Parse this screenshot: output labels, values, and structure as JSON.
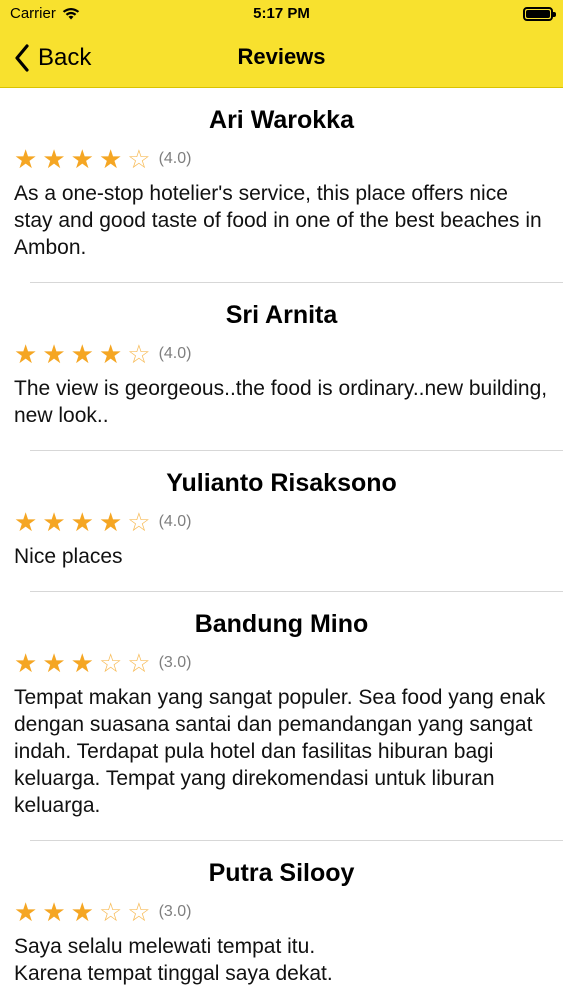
{
  "status": {
    "carrier": "Carrier",
    "time": "5:17 PM"
  },
  "nav": {
    "back": "Back",
    "title": "Reviews"
  },
  "colors": {
    "bar": "#F8E12E",
    "star": "#F5A623"
  },
  "reviews": [
    {
      "name": "Ari Warokka",
      "rating": 4,
      "rating_label": "(4.0)",
      "text": "As a one-stop hotelier's service, this place offers nice stay and good taste of food in one of the best beaches in Ambon."
    },
    {
      "name": "Sri Arnita",
      "rating": 4,
      "rating_label": "(4.0)",
      "text": "The view is georgeous..the food is ordinary..new building, new look.."
    },
    {
      "name": "Yulianto Risaksono",
      "rating": 4,
      "rating_label": "(4.0)",
      "text": "Nice places"
    },
    {
      "name": "Bandung Mino",
      "rating": 3,
      "rating_label": "(3.0)",
      "text": "Tempat makan yang sangat populer.  Sea food yang enak dengan suasana santai dan pemandangan yang sangat indah.  Terdapat pula hotel dan fasilitas hiburan bagi keluarga.  Tempat yang direkomendasi untuk liburan keluarga."
    },
    {
      "name": "Putra Silooy",
      "rating": 3,
      "rating_label": "(3.0)",
      "text": "Saya selalu melewati tempat itu.\nKarena tempat tinggal saya dekat."
    }
  ]
}
